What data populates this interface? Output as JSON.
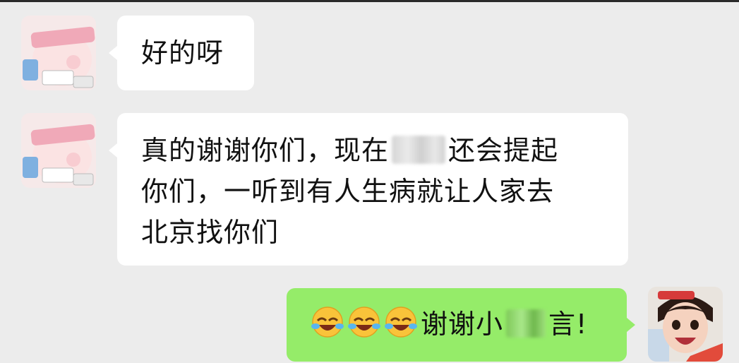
{
  "messages": [
    {
      "side": "incoming",
      "text": "好的呀"
    },
    {
      "side": "incoming",
      "line1_prefix": "真的谢谢你们，现在",
      "line1_suffix": "还会提起",
      "line2": "你们，一听到有人生病就让人家去",
      "line3": "北京找你们"
    },
    {
      "side": "outgoing",
      "emojis": [
        "laughing-crying",
        "laughing-crying",
        "laughing-crying"
      ],
      "text_prefix": "谢谢小",
      "text_suffix": "言!"
    }
  ],
  "colors": {
    "background": "#ececec",
    "incoming_bubble": "#ffffff",
    "outgoing_bubble": "#95ec69"
  }
}
